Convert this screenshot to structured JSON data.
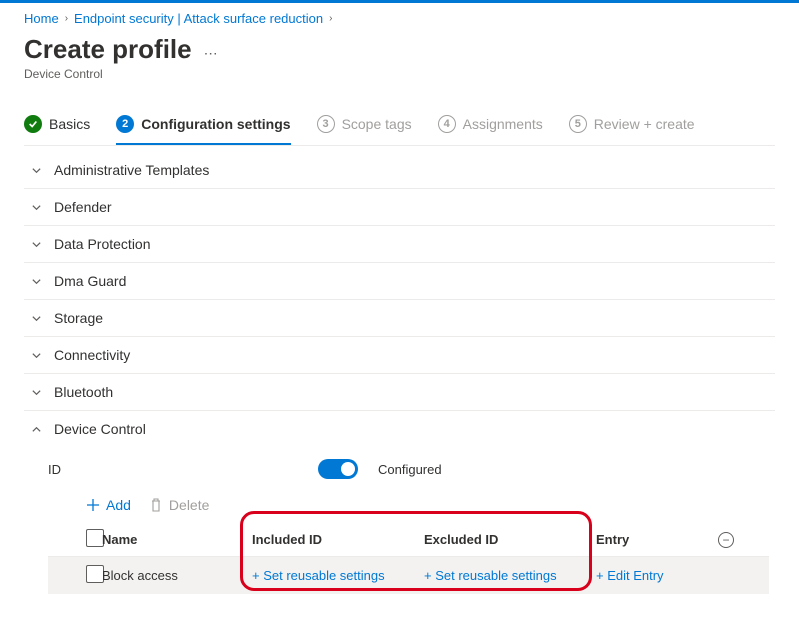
{
  "breadcrumb": {
    "home": "Home",
    "section": "Endpoint security | Attack surface reduction"
  },
  "page": {
    "title": "Create profile",
    "subtitle": "Device Control"
  },
  "wizard": {
    "steps": [
      {
        "num": "✓",
        "label": "Basics"
      },
      {
        "num": "2",
        "label": "Configuration settings"
      },
      {
        "num": "3",
        "label": "Scope tags"
      },
      {
        "num": "4",
        "label": "Assignments"
      },
      {
        "num": "5",
        "label": "Review + create"
      }
    ]
  },
  "sections": {
    "admin": "Administrative Templates",
    "defender": "Defender",
    "dataprot": "Data Protection",
    "dma": "Dma Guard",
    "storage": "Storage",
    "connectivity": "Connectivity",
    "bluetooth": "Bluetooth",
    "devicecontrol": "Device Control"
  },
  "setting": {
    "label": "ID",
    "state": "Configured"
  },
  "toolbar": {
    "add": "Add",
    "delete": "Delete"
  },
  "grid": {
    "headers": {
      "name": "Name",
      "included": "Included ID",
      "excluded": "Excluded ID",
      "entry": "Entry"
    },
    "row": {
      "name": "Block access",
      "included": "+ Set reusable settings",
      "excluded": "+ Set reusable settings",
      "entry": "+ Edit Entry"
    }
  }
}
